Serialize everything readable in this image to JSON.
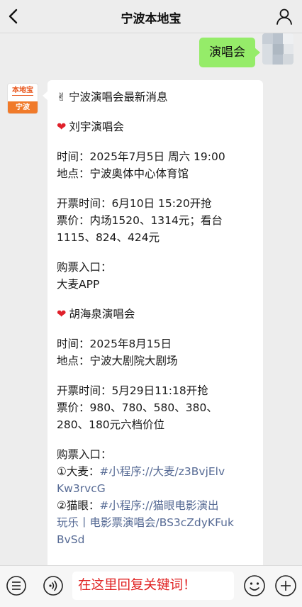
{
  "header": {
    "title": "宁波本地宝",
    "back_icon": "chevron-left-icon",
    "profile_icon": "person-icon"
  },
  "outgoing": {
    "text": "演唱会",
    "bubble_color": "#95ec69"
  },
  "bot": {
    "avatar_logo": "本地宝",
    "avatar_city": "宁波",
    "avatar_color": "#f07a2a"
  },
  "message": {
    "headline": "宁波演唱会最新消息",
    "concerts": [
      {
        "name": "刘宇演唱会",
        "time": "时间：2025年7月5日 周六 19:00",
        "venue": "地点：宁波奥体中心体育馆",
        "sale": "开票时间：6月10日 15:20开抢",
        "price_line1": "票价：内场1520、1314元；看台",
        "price_line2": "1115、824、424元",
        "entry_label": "购票入口：",
        "entry_value": "大麦APP"
      },
      {
        "name": "胡海泉演唱会",
        "time": "时间：2025年8月15日",
        "venue": "地点：宁波大剧院大剧场",
        "sale": "开票时间：5月29日11:18开抢",
        "price_line1": "票价：980、780、580、380、",
        "price_line2": "280、180元六档价位",
        "entry_label": "购票入口：",
        "entry1_prefix": "①大麦：",
        "entry1_link_a": "#小程序://大麦/z3BvjElv",
        "entry1_link_b": "Kw3rvcG",
        "entry2_prefix": "②猫眼：",
        "entry2_link_a": "#小程序://猫眼电影演出",
        "entry2_link_b": "玩乐丨电影票演唱会/BS3cZdyKFuk",
        "entry2_link_c": "BvSd"
      }
    ],
    "link_color": "#576b95"
  },
  "bottom": {
    "input_text": "在这里回复关键词！",
    "input_color": "#e02020",
    "menu_icon": "list-menu-icon",
    "voice_icon": "voice-icon",
    "emoji_icon": "emoji-icon",
    "plus_icon": "plus-icon"
  }
}
